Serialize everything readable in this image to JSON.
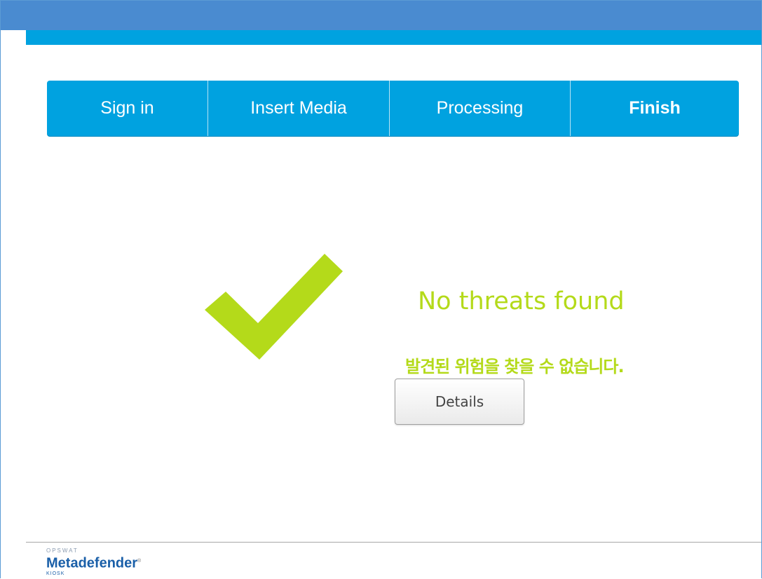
{
  "steps": {
    "sign_in": "Sign in",
    "insert_media": "Insert Media",
    "processing": "Processing",
    "finish": "Finish"
  },
  "result": {
    "headline": "No threats found",
    "subline": "발견된 위험을 찾을 수 없습니다.",
    "details_label": "Details",
    "status_color": "#b4da1a",
    "icon": "checkmark-icon"
  },
  "footer": {
    "brand_small": "OPSWAT",
    "brand_main": "Metadefender",
    "brand_trademark": "®",
    "brand_kiosk": "KIOSK"
  },
  "colors": {
    "titlebar": "#4a8bd0",
    "accent": "#00a2e0"
  }
}
